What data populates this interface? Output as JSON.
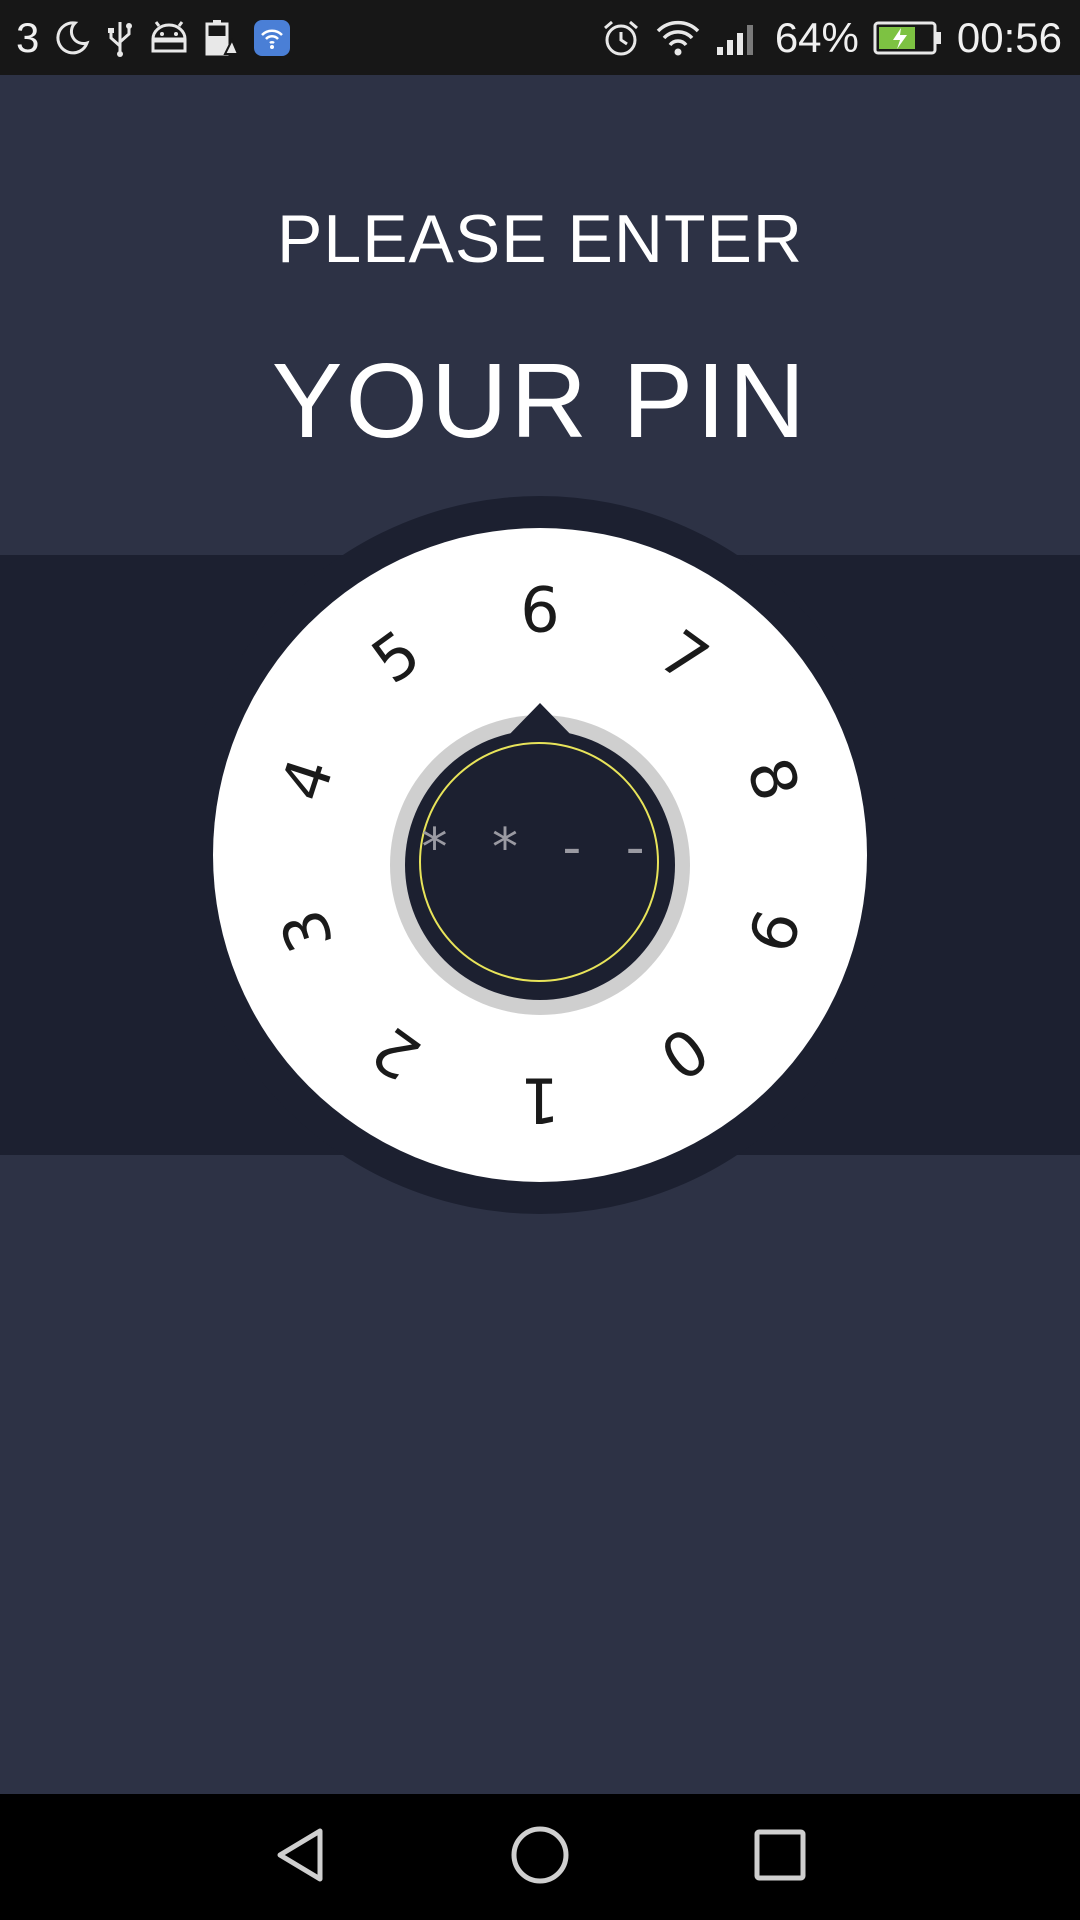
{
  "status_bar": {
    "notification_count": "3",
    "left_icons": [
      "moon-icon",
      "usb-icon",
      "android-debug-icon",
      "battery-warning-icon",
      "wifi-app-icon"
    ],
    "right_icons": [
      "alarm-icon",
      "wifi-icon",
      "signal-icon",
      "battery-charging-icon"
    ],
    "battery_percent": "64%",
    "time": "00:56"
  },
  "prompt": {
    "line1": "PLEASE ENTER",
    "line2": "YOUR PIN"
  },
  "dial": {
    "digits": [
      "6",
      "7",
      "8",
      "9",
      "0",
      "1",
      "2",
      "3",
      "4",
      "5"
    ],
    "pin_display": "* * - -",
    "pin_length": 4,
    "digits_entered": 2
  },
  "nav_bar": {
    "buttons": [
      "back-icon",
      "home-icon",
      "recents-icon"
    ]
  },
  "colors": {
    "background": "#2d3245",
    "band": "#1c2030",
    "dial": "#ffffff",
    "ring_accent": "#e8e45a",
    "status_bar": "#171717",
    "nav_bar": "#000000"
  }
}
